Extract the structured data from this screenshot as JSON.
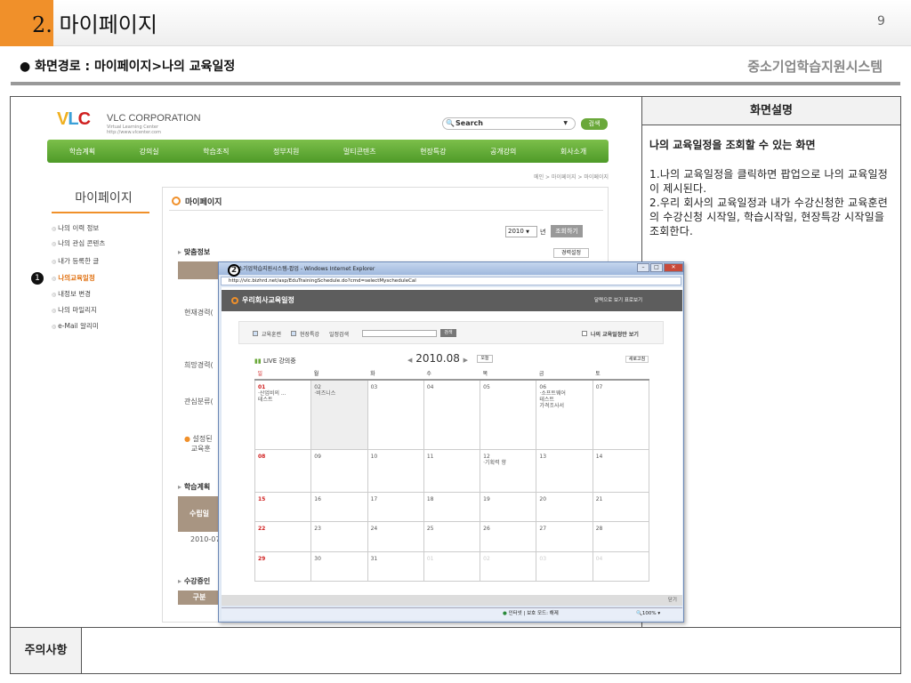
{
  "slide": {
    "title_number": "2.",
    "title_text": "마이페이지",
    "page_number": "9",
    "path": "● 화면경로 : 마이페이지>나의 교육일정",
    "system_name": "중소기업학습지원시스템"
  },
  "description": {
    "header": "화면설명",
    "title": "나의 교육일정을 조회할 수 있는 화면",
    "line1": "1.나의 교육일정을 클릭하면 팝업으로 나의 교육일정이 제시된다.",
    "line2": "2.우리 회사의 교육일정과 내가 수강신청한 교육훈련의 수강신청 시작일, 학습시작일, 현장특강 시작일을 조회한다."
  },
  "notes": {
    "label": "주의사항"
  },
  "site": {
    "logo": "VLC",
    "corp": "VLC CORPORATION",
    "corp_sub1": "Virtual Learning Center",
    "corp_sub2": "http://www.vlcenter.com",
    "search_placeholder": "Search",
    "search_button": "검색",
    "nav": [
      "학습계획",
      "강의실",
      "학습조직",
      "정부지원",
      "멀티콘텐츠",
      "현장특강",
      "공개강의",
      "회사소개"
    ],
    "breadcrumb": "메인 > 마이페이지 > 마이페이지",
    "side_title": "마이페이지",
    "side_items": [
      "나의 이력 정보",
      "나의 관심 콘텐츠",
      "내가 등록한 글",
      "나의교육일정",
      "내정보 변경",
      "나의 마일리지",
      "e-Mail 알리미"
    ],
    "content_title": "마이페이지",
    "year": "2010",
    "year_unit": "년",
    "year_button": "조회하기",
    "section_info": "맞춤정보",
    "career_button": "경력설정",
    "row1": "현재경력(",
    "row2": "희망경력(",
    "row3": "관심분류(",
    "info_note1": "설정된",
    "info_note2": "교육훈",
    "section_plan": "학습계획",
    "plan_head": "수립일",
    "plan_date": "2010-07",
    "section_course": "수강중인",
    "course_head": "구분"
  },
  "annotations": {
    "b1": "1",
    "b2": "2"
  },
  "popup": {
    "window_title": "중소기업학습지원시스템-팝업 - Windows Internet Explorer",
    "url": "http://vlc.bizhrd.net/asp/EduTrainingSchedule.do?cmd=selectMyscheduleCal",
    "header_title": "우리회사교육일정",
    "header_links": "달력으로 보기  표로보기",
    "filter_edu": "교육훈련",
    "filter_field": "현장특강",
    "filter_search": "일정검색",
    "filter_button": "검색",
    "filter_mine": "나의 교육일정만 보기",
    "live_label": "LIVE 강의중",
    "month": "2010.08",
    "today_button": "오늘",
    "refresh_button": "새로고침",
    "weekdays": [
      "일",
      "월",
      "화",
      "수",
      "목",
      "금",
      "토"
    ],
    "close_label": "닫기",
    "status_zone": "인터넷 | 보호 모드: 해제",
    "status_zoom": "100%",
    "weeks": [
      [
        [
          "01",
          "·산업비의 ...\n테스트"
        ],
        [
          "02",
          "·비즈니스"
        ],
        [
          "03",
          ""
        ],
        [
          "04",
          ""
        ],
        [
          "05",
          ""
        ],
        [
          "06",
          "·소프트웨어\n테스트\n가격조사서"
        ],
        [
          "07",
          ""
        ]
      ],
      [
        [
          "08",
          ""
        ],
        [
          "09",
          ""
        ],
        [
          "10",
          ""
        ],
        [
          "11",
          ""
        ],
        [
          "12",
          "·기획력 향"
        ],
        [
          "13",
          ""
        ],
        [
          "14",
          ""
        ]
      ],
      [
        [
          "15",
          ""
        ],
        [
          "16",
          ""
        ],
        [
          "17",
          ""
        ],
        [
          "18",
          ""
        ],
        [
          "19",
          ""
        ],
        [
          "20",
          ""
        ],
        [
          "21",
          ""
        ]
      ],
      [
        [
          "22",
          ""
        ],
        [
          "23",
          ""
        ],
        [
          "24",
          ""
        ],
        [
          "25",
          ""
        ],
        [
          "26",
          ""
        ],
        [
          "27",
          ""
        ],
        [
          "28",
          ""
        ]
      ],
      [
        [
          "29",
          ""
        ],
        [
          "30",
          ""
        ],
        [
          "31",
          ""
        ],
        [
          "01",
          ""
        ],
        [
          "02",
          ""
        ],
        [
          "03",
          ""
        ],
        [
          "04",
          ""
        ]
      ]
    ]
  }
}
